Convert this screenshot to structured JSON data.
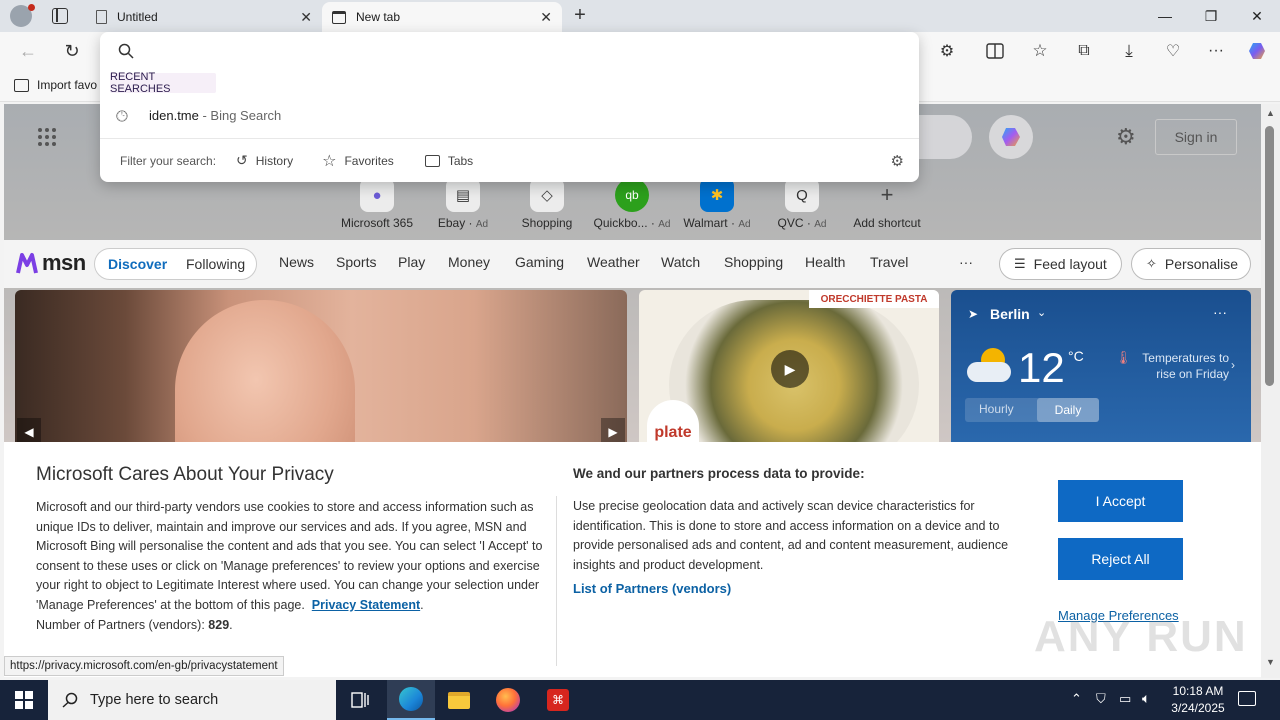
{
  "browser": {
    "tabs": [
      {
        "title": "Untitled"
      },
      {
        "title": "New tab"
      }
    ],
    "favorites_bar": {
      "import_label": "Import favo"
    }
  },
  "omnibox": {
    "query": "",
    "recent_label": "RECENT SEARCHES",
    "suggestion": {
      "text": "iden.tme",
      "suffix": " - Bing Search"
    },
    "filter_label": "Filter your search:",
    "filters": [
      "History",
      "Favorites",
      "Tabs"
    ]
  },
  "ntp": {
    "sign_in": "Sign in",
    "shortcuts": [
      {
        "label": "Microsoft 365",
        "ad": ""
      },
      {
        "label": "Ebay",
        "ad": "Ad"
      },
      {
        "label": "Shopping",
        "ad": ""
      },
      {
        "label": "Quickbo...",
        "ad": "Ad"
      },
      {
        "label": "Walmart",
        "ad": "Ad"
      },
      {
        "label": "QVC",
        "ad": "Ad"
      },
      {
        "label": "Add shortcut",
        "ad": ""
      }
    ],
    "msn_logo": "msn",
    "nav": {
      "discover": "Discover",
      "following": "Following",
      "items": [
        "News",
        "Sports",
        "Play",
        "Money",
        "Gaming",
        "Weather",
        "Watch",
        "Shopping",
        "Health",
        "Travel"
      ],
      "more": "···",
      "feed_layout": "Feed layout",
      "personalise": "Personalise"
    },
    "food_card": {
      "banner": "ORECCHIETTE PASTA",
      "brand": "plate"
    },
    "weather": {
      "city": "Berlin",
      "temp": "12",
      "unit": "°C",
      "note": "Temperatures to rise on Friday",
      "tab_hourly": "Hourly",
      "tab_daily": "Daily"
    }
  },
  "privacy": {
    "title": "Microsoft Cares About Your Privacy",
    "body": "Microsoft and our third-party vendors use cookies to store and access information such as unique IDs to deliver, maintain and improve our services and ads. If you agree, MSN and Microsoft Bing will personalise the content and ads that you see. You can select 'I Accept' to consent to these uses or click on 'Manage preferences' to review your options and exercise your right to object to Legitimate Interest where used.  You can change your selection under 'Manage Preferences' at the bottom of this page.",
    "privacy_link": "Privacy Statement",
    "partners_prefix": "Number of Partners (vendors): ",
    "partners_count": "829",
    "purpose_title": "We and our partners process data to provide:",
    "purpose_body": "Use precise geolocation data and actively scan device characteristics for identification. This is done to store and access information on a device and to provide personalised ads and content, ad and content measurement, audience insights and product development.",
    "partners_link": "List of Partners (vendors)",
    "accept": "I Accept",
    "reject": "Reject All",
    "manage": "Manage Preferences"
  },
  "status_url": "https://privacy.microsoft.com/en-gb/privacystatement",
  "watermark": "ANY RUN",
  "taskbar": {
    "search_placeholder": "Type here to search",
    "time": "10:18 AM",
    "date": "3/24/2025"
  }
}
